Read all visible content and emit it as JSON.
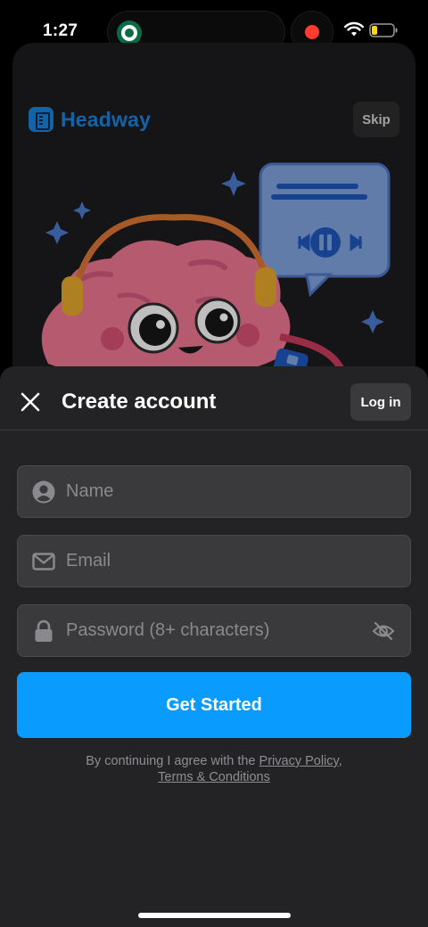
{
  "status_bar": {
    "time": "1:27"
  },
  "onboarding": {
    "brand_name": "Headway",
    "skip_label": "Skip"
  },
  "sheet": {
    "title": "Create account",
    "login_label": "Log in",
    "fields": {
      "name_placeholder": "Name",
      "email_placeholder": "Email",
      "password_placeholder": "Password (8+ characters)"
    },
    "cta_label": "Get Started",
    "legal": {
      "prefix": "By continuing I agree with the ",
      "privacy_link": "Privacy Policy",
      "separator": ",",
      "terms_link": "Terms & Conditions"
    }
  },
  "colors": {
    "accent": "#0a9bff",
    "brand": "#1b7fd6",
    "sheet_bg": "#232325",
    "field_bg": "#3a3a3c"
  },
  "icons": [
    "starbucks-app-icon",
    "record-icon",
    "wifi-icon",
    "battery-icon",
    "close-icon",
    "user-icon",
    "mail-icon",
    "lock-icon",
    "eye-off-icon"
  ]
}
